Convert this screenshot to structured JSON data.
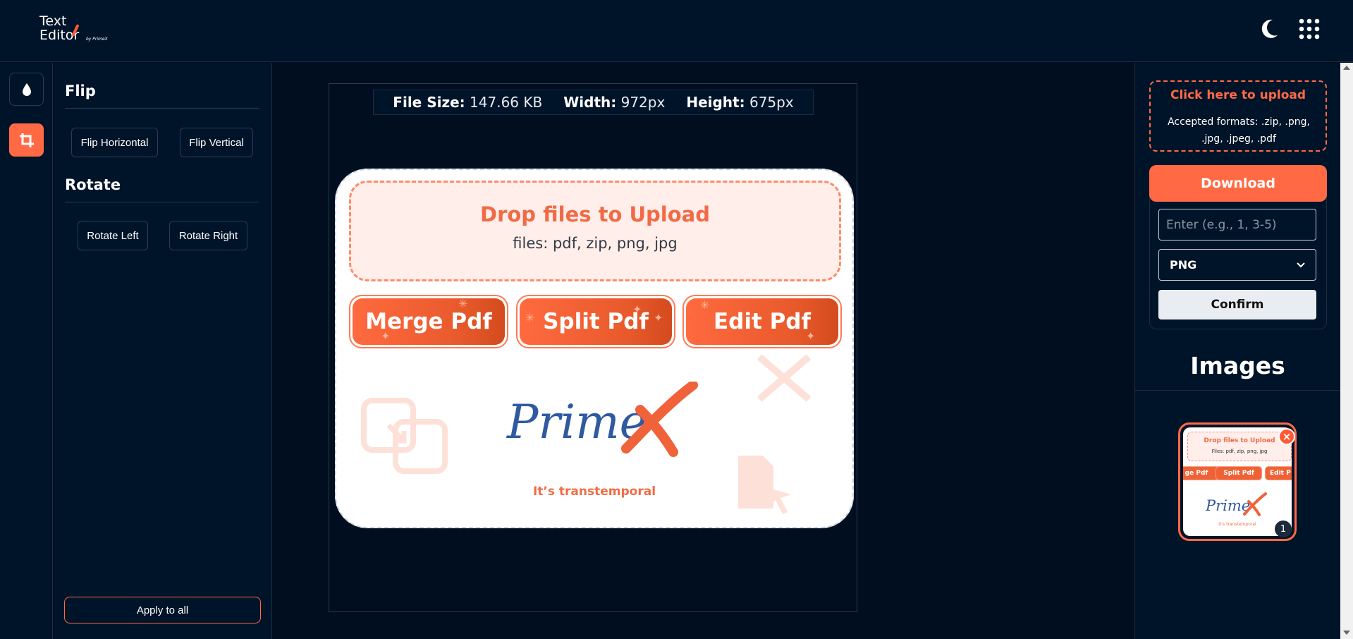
{
  "header": {
    "logo_line1": "Text",
    "logo_line2": "Editor",
    "logo_byline": "by PrimeX",
    "theme_icon": "moon-icon",
    "apps_icon": "grid-icon"
  },
  "rail": {
    "items": [
      {
        "icon": "droplet-icon",
        "active": false
      },
      {
        "icon": "crop-icon",
        "active": true
      }
    ]
  },
  "panel": {
    "flip_title": "Flip",
    "flip_horizontal": "Flip Horizontal",
    "flip_vertical": "Flip Vertical",
    "rotate_title": "Rotate",
    "rotate_left": "Rotate Left",
    "rotate_right": "Rotate Right",
    "apply_all": "Apply to all"
  },
  "canvas": {
    "file_size_label": "File Size:",
    "file_size_value": "147.66 KB",
    "width_label": "Width:",
    "width_value": "972px",
    "height_label": "Height:",
    "height_value": "675px",
    "preview": {
      "drop_title": "Drop files to Upload",
      "drop_sub": "files: pdf, zip, png, jpg",
      "pill_merge": "Merge Pdf",
      "pill_split": "Split Pdf",
      "pill_edit": "Edit Pdf",
      "tagline": "It’s transtemporal"
    }
  },
  "right": {
    "upload_title": "Click here to upload",
    "upload_formats": "Accepted formats: .zip, .png, .jpg, .jpeg, .pdf",
    "download": "Download",
    "range_placeholder": "Enter (e.g., 1, 3-5)",
    "format_value": "PNG",
    "confirm": "Confirm",
    "images_title": "Images",
    "thumb": {
      "drop_title": "Drop files to Upload",
      "drop_sub": "Files: pdf, zip, png, jpg",
      "pill_merge": "ge Pdf",
      "pill_split": "Split Pdf",
      "pill_edit": "Edit P",
      "tagline": "It's transtemporal",
      "index": "1"
    }
  },
  "colors": {
    "accent": "#ff6a45",
    "background": "#000e1f",
    "panel": "#001429"
  }
}
